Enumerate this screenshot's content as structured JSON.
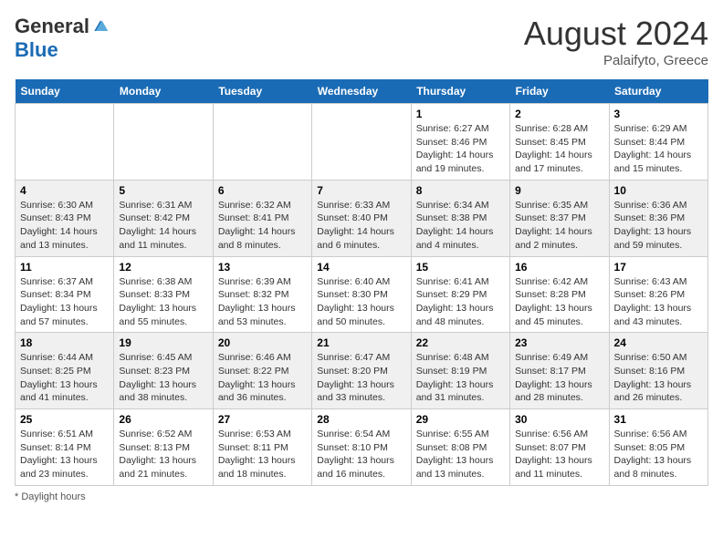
{
  "header": {
    "logo_general": "General",
    "logo_blue": "Blue",
    "month_year": "August 2024",
    "location": "Palaifyto, Greece"
  },
  "days_of_week": [
    "Sunday",
    "Monday",
    "Tuesday",
    "Wednesday",
    "Thursday",
    "Friday",
    "Saturday"
  ],
  "weeks": [
    [
      {
        "day": "",
        "info": ""
      },
      {
        "day": "",
        "info": ""
      },
      {
        "day": "",
        "info": ""
      },
      {
        "day": "",
        "info": ""
      },
      {
        "day": "1",
        "info": "Sunrise: 6:27 AM\nSunset: 8:46 PM\nDaylight: 14 hours and 19 minutes."
      },
      {
        "day": "2",
        "info": "Sunrise: 6:28 AM\nSunset: 8:45 PM\nDaylight: 14 hours and 17 minutes."
      },
      {
        "day": "3",
        "info": "Sunrise: 6:29 AM\nSunset: 8:44 PM\nDaylight: 14 hours and 15 minutes."
      }
    ],
    [
      {
        "day": "4",
        "info": "Sunrise: 6:30 AM\nSunset: 8:43 PM\nDaylight: 14 hours and 13 minutes."
      },
      {
        "day": "5",
        "info": "Sunrise: 6:31 AM\nSunset: 8:42 PM\nDaylight: 14 hours and 11 minutes."
      },
      {
        "day": "6",
        "info": "Sunrise: 6:32 AM\nSunset: 8:41 PM\nDaylight: 14 hours and 8 minutes."
      },
      {
        "day": "7",
        "info": "Sunrise: 6:33 AM\nSunset: 8:40 PM\nDaylight: 14 hours and 6 minutes."
      },
      {
        "day": "8",
        "info": "Sunrise: 6:34 AM\nSunset: 8:38 PM\nDaylight: 14 hours and 4 minutes."
      },
      {
        "day": "9",
        "info": "Sunrise: 6:35 AM\nSunset: 8:37 PM\nDaylight: 14 hours and 2 minutes."
      },
      {
        "day": "10",
        "info": "Sunrise: 6:36 AM\nSunset: 8:36 PM\nDaylight: 13 hours and 59 minutes."
      }
    ],
    [
      {
        "day": "11",
        "info": "Sunrise: 6:37 AM\nSunset: 8:34 PM\nDaylight: 13 hours and 57 minutes."
      },
      {
        "day": "12",
        "info": "Sunrise: 6:38 AM\nSunset: 8:33 PM\nDaylight: 13 hours and 55 minutes."
      },
      {
        "day": "13",
        "info": "Sunrise: 6:39 AM\nSunset: 8:32 PM\nDaylight: 13 hours and 53 minutes."
      },
      {
        "day": "14",
        "info": "Sunrise: 6:40 AM\nSunset: 8:30 PM\nDaylight: 13 hours and 50 minutes."
      },
      {
        "day": "15",
        "info": "Sunrise: 6:41 AM\nSunset: 8:29 PM\nDaylight: 13 hours and 48 minutes."
      },
      {
        "day": "16",
        "info": "Sunrise: 6:42 AM\nSunset: 8:28 PM\nDaylight: 13 hours and 45 minutes."
      },
      {
        "day": "17",
        "info": "Sunrise: 6:43 AM\nSunset: 8:26 PM\nDaylight: 13 hours and 43 minutes."
      }
    ],
    [
      {
        "day": "18",
        "info": "Sunrise: 6:44 AM\nSunset: 8:25 PM\nDaylight: 13 hours and 41 minutes."
      },
      {
        "day": "19",
        "info": "Sunrise: 6:45 AM\nSunset: 8:23 PM\nDaylight: 13 hours and 38 minutes."
      },
      {
        "day": "20",
        "info": "Sunrise: 6:46 AM\nSunset: 8:22 PM\nDaylight: 13 hours and 36 minutes."
      },
      {
        "day": "21",
        "info": "Sunrise: 6:47 AM\nSunset: 8:20 PM\nDaylight: 13 hours and 33 minutes."
      },
      {
        "day": "22",
        "info": "Sunrise: 6:48 AM\nSunset: 8:19 PM\nDaylight: 13 hours and 31 minutes."
      },
      {
        "day": "23",
        "info": "Sunrise: 6:49 AM\nSunset: 8:17 PM\nDaylight: 13 hours and 28 minutes."
      },
      {
        "day": "24",
        "info": "Sunrise: 6:50 AM\nSunset: 8:16 PM\nDaylight: 13 hours and 26 minutes."
      }
    ],
    [
      {
        "day": "25",
        "info": "Sunrise: 6:51 AM\nSunset: 8:14 PM\nDaylight: 13 hours and 23 minutes."
      },
      {
        "day": "26",
        "info": "Sunrise: 6:52 AM\nSunset: 8:13 PM\nDaylight: 13 hours and 21 minutes."
      },
      {
        "day": "27",
        "info": "Sunrise: 6:53 AM\nSunset: 8:11 PM\nDaylight: 13 hours and 18 minutes."
      },
      {
        "day": "28",
        "info": "Sunrise: 6:54 AM\nSunset: 8:10 PM\nDaylight: 13 hours and 16 minutes."
      },
      {
        "day": "29",
        "info": "Sunrise: 6:55 AM\nSunset: 8:08 PM\nDaylight: 13 hours and 13 minutes."
      },
      {
        "day": "30",
        "info": "Sunrise: 6:56 AM\nSunset: 8:07 PM\nDaylight: 13 hours and 11 minutes."
      },
      {
        "day": "31",
        "info": "Sunrise: 6:56 AM\nSunset: 8:05 PM\nDaylight: 13 hours and 8 minutes."
      }
    ]
  ],
  "footer": {
    "note": "Daylight hours"
  }
}
